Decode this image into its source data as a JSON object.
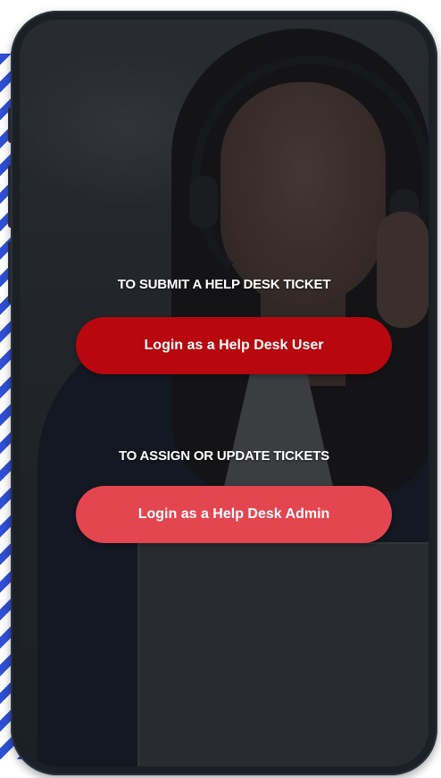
{
  "prompts": {
    "submit": "TO SUBMIT A HELP DESK TICKET",
    "assign": "TO ASSIGN OR UPDATE TICKETS"
  },
  "buttons": {
    "user_login": "Login as a Help Desk User",
    "admin_login": "Login as a Help Desk Admin"
  },
  "colors": {
    "user_button": "#b8070e",
    "admin_button": "#e4464f",
    "stripe_accent": "#2f4fd6"
  }
}
